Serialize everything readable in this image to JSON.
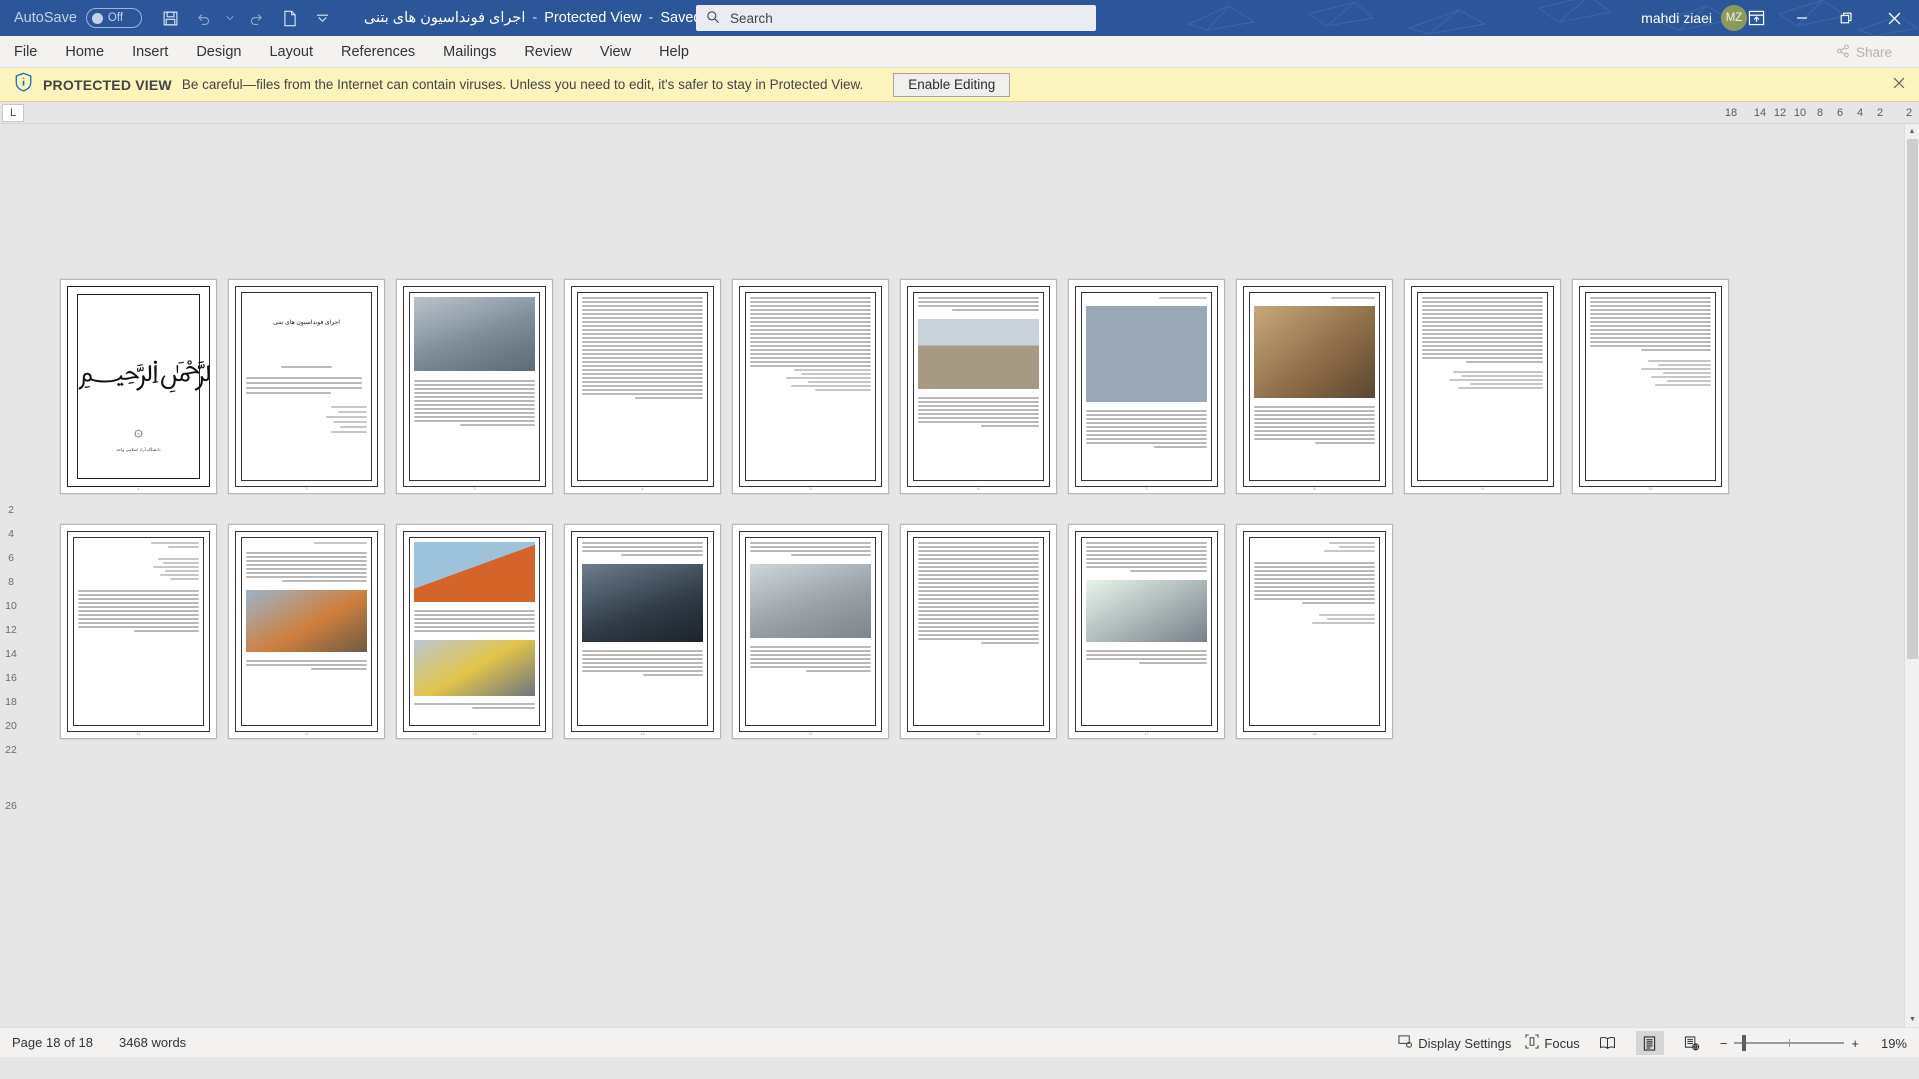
{
  "titlebar": {
    "autosave_label": "AutoSave",
    "autosave_state": "Off",
    "save_icon": "save-icon",
    "undo_icon": "undo-icon",
    "redo_icon": "redo-icon",
    "newdoc_icon": "new-document-icon",
    "customize_icon": "customize-quick-access-icon",
    "doc_name": "اجرای فونداسیون های بتنی",
    "protected_view_label": "Protected View",
    "saved_label": "Saved to this PC",
    "title_caret": "▾",
    "user_name": "mahdi ziaei",
    "user_initials": "MZ",
    "ribbon_display_icon": "ribbon-display-options-icon",
    "minimize": "—",
    "restore": "❐",
    "close": "✕"
  },
  "search": {
    "placeholder": "Search",
    "value": "",
    "icon": "search-icon"
  },
  "ribbon": {
    "tabs": [
      {
        "label": "File"
      },
      {
        "label": "Home"
      },
      {
        "label": "Insert"
      },
      {
        "label": "Design"
      },
      {
        "label": "Layout"
      },
      {
        "label": "References"
      },
      {
        "label": "Mailings"
      },
      {
        "label": "Review"
      },
      {
        "label": "View"
      },
      {
        "label": "Help"
      }
    ],
    "share_label": "Share",
    "share_icon": "share-icon"
  },
  "protected_view": {
    "icon": "shield-info-icon",
    "title": "PROTECTED VIEW",
    "message": "Be careful—files from the Internet can contain viruses. Unless you need to edit, it's safer to stay in Protected View.",
    "enable_label": "Enable Editing",
    "close_icon": "close-icon"
  },
  "ruler": {
    "corner_label": "L",
    "h_ticks": [
      "18",
      "",
      "14",
      "12",
      "10",
      "8",
      "6",
      "4",
      "2",
      "",
      "2"
    ],
    "v_ticks": [
      "2",
      "4",
      "6",
      "8",
      "10",
      "12",
      "14",
      "16",
      "18",
      "20",
      "22",
      "26"
    ]
  },
  "document": {
    "zoom_percent": "19%",
    "pages": [
      {
        "num": "1",
        "kind": "cover",
        "bism": "﷽",
        "emblem": "۞",
        "emblem_caption": "دانشگاه آزاد اسلامی واحد"
      },
      {
        "num": "2",
        "kind": "title",
        "heading": "اجرای فونداسیون های بتنی",
        "lines": 14
      },
      {
        "num": "3",
        "kind": "image-top",
        "lines": 12
      },
      {
        "num": "4",
        "kind": "text",
        "lines": 26
      },
      {
        "num": "5",
        "kind": "text",
        "lines": 26
      },
      {
        "num": "6",
        "kind": "image-mid",
        "lines": 14
      },
      {
        "num": "7",
        "kind": "image-top",
        "lines": 13
      },
      {
        "num": "8",
        "kind": "image-top",
        "lines": 13
      },
      {
        "num": "9",
        "kind": "text",
        "lines": 27
      },
      {
        "num": "10",
        "kind": "list",
        "lines": 13
      },
      {
        "num": "11",
        "kind": "image-mid",
        "lines": 14
      },
      {
        "num": "12",
        "kind": "image-top",
        "lines": 12
      },
      {
        "num": "13",
        "kind": "image-top",
        "lines": 13
      },
      {
        "num": "14",
        "kind": "image-top",
        "lines": 13
      },
      {
        "num": "15",
        "kind": "text",
        "lines": 26
      },
      {
        "num": "16",
        "kind": "text",
        "lines": 26
      },
      {
        "num": "17",
        "kind": "image-mid",
        "lines": 16
      },
      {
        "num": "18",
        "kind": "list",
        "lines": 14
      }
    ]
  },
  "statusbar": {
    "page_label": "Page 18 of 18",
    "word_count": "3468 words",
    "display_settings_label": "Display Settings",
    "display_settings_icon": "display-settings-icon",
    "focus_label": "Focus",
    "focus_icon": "focus-icon",
    "read_mode_icon": "read-mode-icon",
    "print_layout_icon": "print-layout-icon",
    "web_layout_icon": "web-layout-icon",
    "zoom_out": "−",
    "zoom_in": "+",
    "zoom_value": "19%"
  },
  "colors": {
    "titlebar": "#2b579a",
    "ribbon": "#f3f2f1",
    "protected_bar": "#fcf4bd",
    "workspace": "#e6e6e6",
    "avatar": "#8a9a5b"
  }
}
